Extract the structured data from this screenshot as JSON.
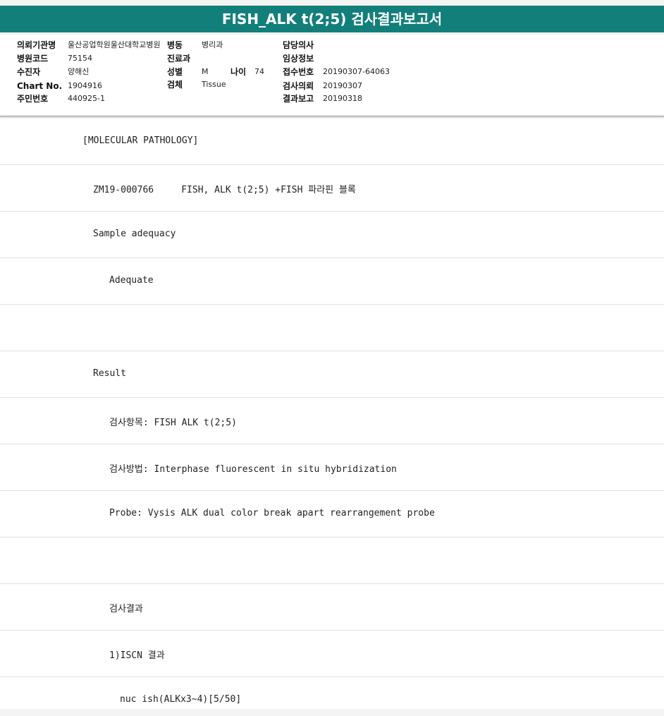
{
  "header": {
    "title": "FISH_ALK t(2;5) 검사결과보고서"
  },
  "info": {
    "institution_label": "의뢰기관명",
    "institution_value": "울산공업학원울산대학교병원",
    "ward_label": "병동",
    "ward_value": "병리과",
    "doctor_label": "담당의사",
    "doctor_value": "",
    "hospital_code_label": "병원코드",
    "hospital_code_value": "75154",
    "department_label": "진료과",
    "department_value": "",
    "clinical_info_label": "임상정보",
    "clinical_info_value": "",
    "patient_label": "수진자",
    "patient_value": "양해신",
    "sex_label": "성별",
    "sex_value": "M",
    "age_label": "나이",
    "age_value": "74",
    "receipt_no_label": "접수번호",
    "receipt_no_value": "20190307-64063",
    "chart_no_label": "Chart No.",
    "chart_no_value": "1904916",
    "specimen_label": "검체",
    "specimen_value": "Tissue",
    "request_date_label": "검사의뢰",
    "request_date_value": "20190307",
    "resident_no_label": "주민번호",
    "resident_no_value": "440925-1",
    "report_date_label": "결과보고",
    "report_date_value": "20190318"
  },
  "report_lines": [
    "[MOLECULAR PATHOLOGY]",
    "ZM19-000766     FISH, ALK t(2;5) +FISH 파라핀 블록",
    "Sample adequacy",
    "Adequate",
    "",
    "Result",
    "검사항목: FISH ALK t(2;5)",
    "검사방법: Interphase fluorescent in situ hybridization",
    "Probe: Vysis ALK dual color break apart rearrangement probe",
    "",
    "검사결과",
    "1)ISCN 결과",
    "nuc ish(ALKx3~4)[5/50]"
  ]
}
